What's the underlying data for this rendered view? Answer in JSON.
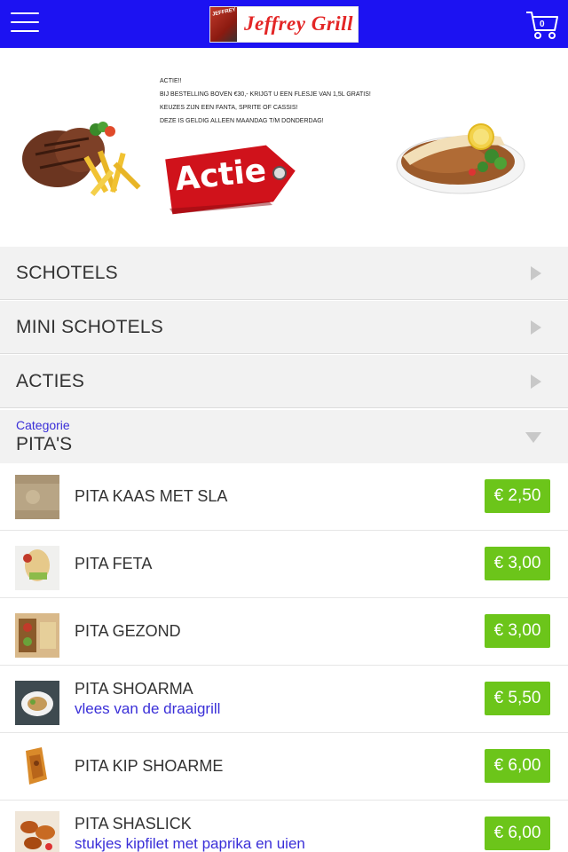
{
  "header": {
    "logo_text": "Jeffrey Grill",
    "logo_mark_text": "JEFFREY",
    "cart_count": "0",
    "bar_color": "#1c12f2"
  },
  "banner": {
    "promo_lines": [
      "ACTIE!!",
      "BIJ BESTELLING BOVEN €30,- KRIJGT U EEN FLESJE VAN 1,5L GRATIS!",
      "KEUZES ZIJN EEN FANTA, SPRITE OF CASSIS!",
      "DEZE IS GELDIG ALLEEN MAANDAG T/M DONDERDAG!"
    ],
    "tag_label": "Actie"
  },
  "categories": [
    {
      "label": "SCHOTELS"
    },
    {
      "label": "MINI SCHOTELS"
    },
    {
      "label": "ACTIES"
    }
  ],
  "open_category": {
    "caption": "Categorie",
    "label": "PITA'S"
  },
  "items": [
    {
      "name": "PITA KAAS MET SLA",
      "desc": "",
      "price": "€ 2,50"
    },
    {
      "name": "PITA FETA",
      "desc": "",
      "price": "€ 3,00"
    },
    {
      "name": "PITA GEZOND",
      "desc": "",
      "price": "€ 3,00"
    },
    {
      "name": "PITA SHOARMA",
      "desc": "vlees van de draaigrill",
      "price": "€ 5,50"
    },
    {
      "name": "PITA KIP SHOARME",
      "desc": "",
      "price": "€ 6,00"
    },
    {
      "name": "PITA SHASLICK",
      "desc": "stukjes kipfilet met paprika en uien",
      "price": "€ 6,00"
    }
  ],
  "colors": {
    "price_green": "#6cc51a",
    "accent_purple": "#3a2fd8",
    "tag_red": "#d0121b"
  }
}
